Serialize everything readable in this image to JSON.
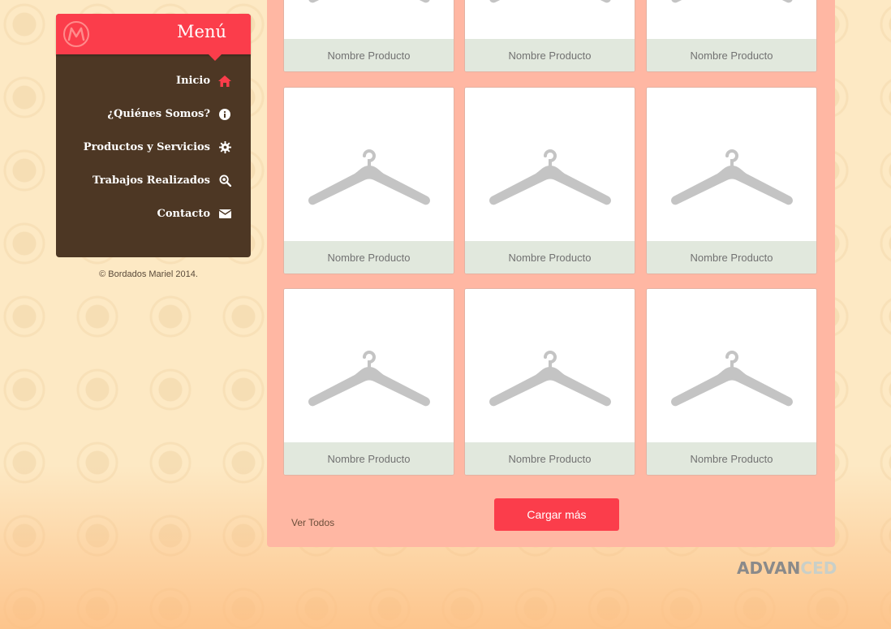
{
  "sidebar": {
    "title": "Menú",
    "items": [
      {
        "label": "Inicio",
        "icon": "home-icon"
      },
      {
        "label": "¿Quiénes Somos?",
        "icon": "info-icon"
      },
      {
        "label": "Productos y Servicios",
        "icon": "gear-icon"
      },
      {
        "label": "Trabajos Realizados",
        "icon": "magnifier-icon"
      },
      {
        "label": "Contacto",
        "icon": "envelope-icon"
      }
    ],
    "copyright": "© Bordados Mariel 2014."
  },
  "products": [
    {
      "name": "Nombre Producto"
    },
    {
      "name": "Nombre Producto"
    },
    {
      "name": "Nombre Producto"
    },
    {
      "name": "Nombre Producto"
    },
    {
      "name": "Nombre Producto"
    },
    {
      "name": "Nombre Producto"
    },
    {
      "name": "Nombre Producto"
    },
    {
      "name": "Nombre Producto"
    },
    {
      "name": "Nombre Producto"
    }
  ],
  "footer": {
    "ver_todos": "Ver Todos",
    "load_more": "Cargar más"
  },
  "brand": {
    "part1": "ADVAN",
    "part2": "CED"
  },
  "colors": {
    "accent": "#fb3d4b",
    "sidebar": "#4d3724",
    "panel": "#ffb7a3"
  }
}
